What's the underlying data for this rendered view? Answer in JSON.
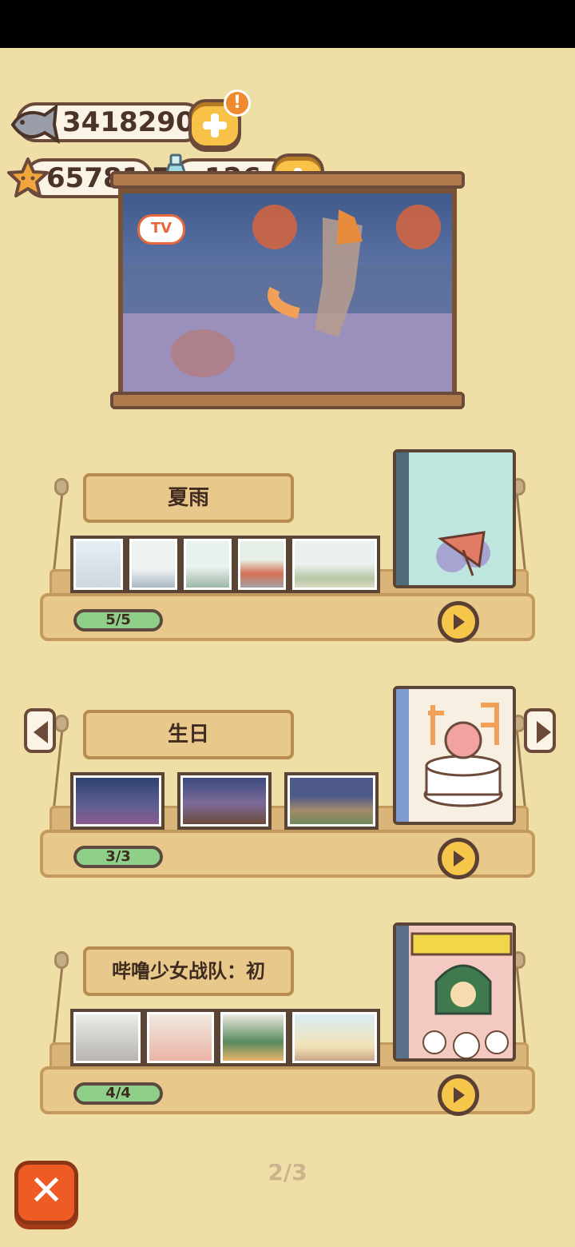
{
  "currency": {
    "fish": "3418290",
    "star": "65781.5",
    "bottle": "126",
    "alert_badge": "!"
  },
  "icons": {
    "fish": "fish-icon",
    "star": "star-coin-icon",
    "bottle": "bottle-icon",
    "plus": "plus-icon",
    "play": "play-icon",
    "close": "close-icon",
    "left": "chevron-left-icon",
    "right": "chevron-right-icon"
  },
  "tv": {
    "logo": "TV"
  },
  "albums": [
    {
      "title": "夏雨",
      "progress": "5/5",
      "photos": 5
    },
    {
      "title": "生日",
      "progress": "3/3",
      "photos": 3
    },
    {
      "title": "哔噜少女战队：初",
      "progress": "4/4",
      "photos": 4
    }
  ],
  "pagination": {
    "page": "2/3"
  },
  "colors": {
    "background": "#efdea6",
    "accent_yellow": "#f6c64a",
    "close_orange": "#ef5b25",
    "progress_green": "#8ed08a"
  }
}
